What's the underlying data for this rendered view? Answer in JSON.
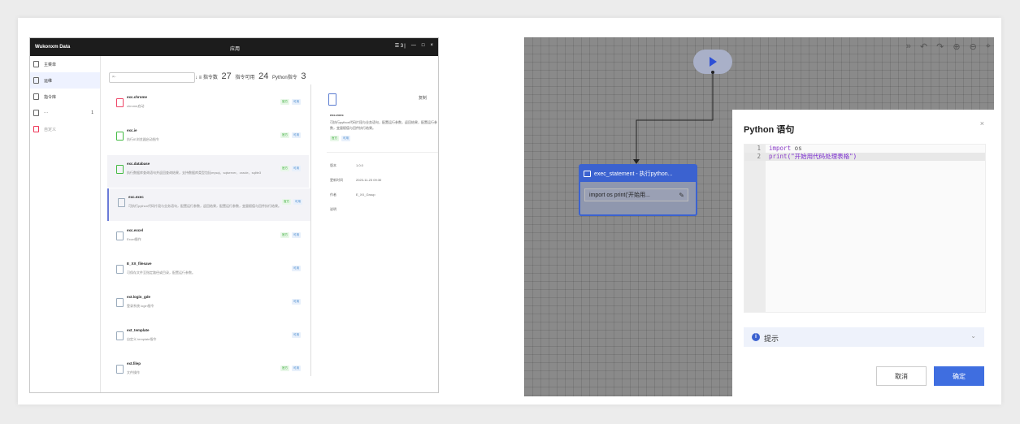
{
  "left_app": {
    "title": "Wukonxm Data",
    "window_title": "应用",
    "controls": [
      "☰ 3 |",
      "—",
      "□",
      "×"
    ],
    "sidebar": [
      {
        "label": "主菜单"
      },
      {
        "label": "运维"
      },
      {
        "label": "指令库"
      },
      {
        "label": "···",
        "right": "1"
      },
      {
        "label": "自定义"
      }
    ],
    "search": {
      "placeholder": "···",
      "clear": "×"
    },
    "stats": {
      "pre": "↓ ≡ 指令数",
      "a": "27",
      "mid1": "指令可用",
      "b": "24",
      "mid2": "Python指令",
      "c": "3"
    },
    "items": [
      {
        "name": "exc.chrome",
        "desc": "chrome启动",
        "tags": [
          "官方",
          "可用"
        ],
        "icon": "red"
      },
      {
        "name": "exc.ie",
        "desc": "执行IE浏览器启动指令",
        "tags": [
          "官方",
          "可用"
        ],
        "icon": "green"
      },
      {
        "name": "exc.database",
        "desc": "执行数据库查询语句并返回查询结果，支持数据库类型包括mysql、sqlserver、oracle、sqlite3",
        "tags": [
          "官方",
          "可用"
        ],
        "icon": "green"
      },
      {
        "name": "exc.exec",
        "desc": "可执行python代码片段与业务语句，配置运行参数，返回结果，配置运行参数，变量赋值与回传执行结果。",
        "tags": [
          "官方",
          "可用"
        ],
        "icon": "blue"
      },
      {
        "name": "exc.excel",
        "desc": "Excel操作",
        "tags": [
          "官方",
          "可用"
        ],
        "icon": "blue"
      },
      {
        "name": "E_XX_filesave",
        "desc": "可保存文件至指定路径或目录，配置运行参数。",
        "tags": [
          "可用"
        ],
        "icon": "blue"
      },
      {
        "name": "ext.login_gde",
        "desc": "登录系统 login指令",
        "tags": [
          "可用"
        ],
        "icon": "blue"
      },
      {
        "name": "ext_template",
        "desc": "自定义 template指令",
        "tags": [
          "可用"
        ],
        "icon": "blue"
      },
      {
        "name": "ext.filep",
        "desc": "文件操作",
        "tags": [
          "官方",
          "可用"
        ],
        "icon": "blue"
      }
    ],
    "detail": {
      "button": "复制",
      "name": "exc.exec",
      "desc": "可执行python代码片段与业务语句，配置运行参数，返回结果，配置运行参数，变量赋值与回传执行结果。",
      "tags": [
        "官方",
        "可用"
      ],
      "rows": [
        {
          "k": "版本",
          "v": "1.0.0"
        },
        {
          "k": "更新时间",
          "v": "2023-11-23 09:30"
        },
        {
          "k": "作者",
          "v": "E_XX_Group"
        },
        {
          "k": "说明",
          "v": ""
        }
      ]
    }
  },
  "canvas": {
    "toolbar": [
      "»",
      "↶",
      "↷",
      "⊕",
      "⊖",
      "⌖"
    ],
    "node": {
      "title": "exec_statement - 执行python...",
      "body": "import os print('开始用...",
      "edit": "✎"
    }
  },
  "dialog": {
    "title": "Python 语句",
    "close": "×",
    "code": [
      {
        "n": "1",
        "kw": "import",
        "rest": " os"
      },
      {
        "n": "2",
        "kw": "print",
        "rest": "(\"开始用代码处理表格\")"
      }
    ],
    "tip": {
      "icon": "i",
      "label": "提示",
      "chevron": "⌄"
    },
    "cancel": "取消",
    "ok": "确定"
  }
}
